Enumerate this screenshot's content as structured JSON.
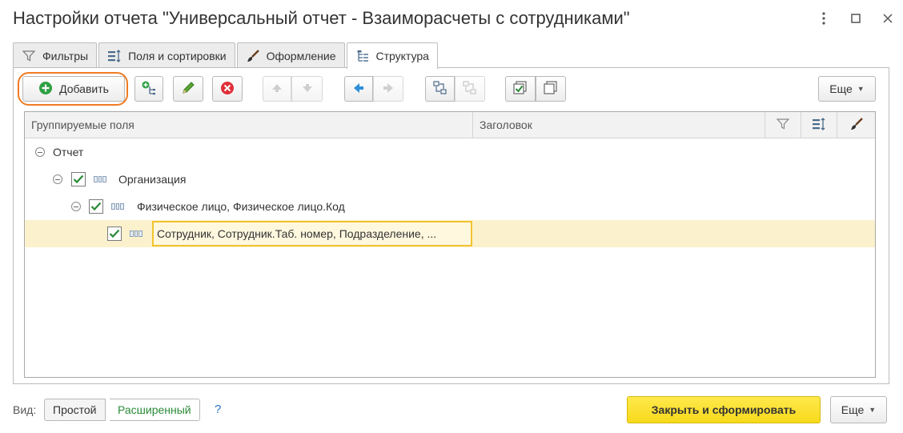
{
  "window": {
    "title": "Настройки отчета \"Универсальный отчет - Взаиморасчеты с сотрудниками\"",
    "menu_icon": "more-vertical-icon",
    "max_icon": "maximize-icon",
    "close_icon": "close-icon"
  },
  "tabs": [
    {
      "label": "Фильтры",
      "icon": "filter-icon"
    },
    {
      "label": "Поля и сортировки",
      "icon": "fields-sort-icon"
    },
    {
      "label": "Оформление",
      "icon": "brush-icon"
    },
    {
      "label": "Структура",
      "icon": "structure-icon",
      "active": true
    }
  ],
  "toolbar": {
    "add_label": "Добавить",
    "more_label": "Еще"
  },
  "grid": {
    "col_fields": "Группируемые поля",
    "col_header": "Заголовок",
    "rows": [
      {
        "text": "Отчет"
      },
      {
        "text": "Организация",
        "checked": true
      },
      {
        "text": "Физическое лицо, Физическое лицо.Код",
        "checked": true
      },
      {
        "text": "Сотрудник, Сотрудник.Таб. номер, Подразделение, ...",
        "checked": true,
        "selected": true
      }
    ]
  },
  "footer": {
    "view_label": "Вид:",
    "simple_label": "Простой",
    "extended_label": "Расширенный",
    "help_label": "?",
    "close_build_label": "Закрыть и сформировать",
    "more_label": "Еще"
  },
  "colors": {
    "accent_green": "#2a8a37",
    "highlight_ring": "#f07c22",
    "primary_button": "#f7d91b",
    "selected_row": "#fbf1cc",
    "selected_cell_border": "#f3c32f"
  }
}
